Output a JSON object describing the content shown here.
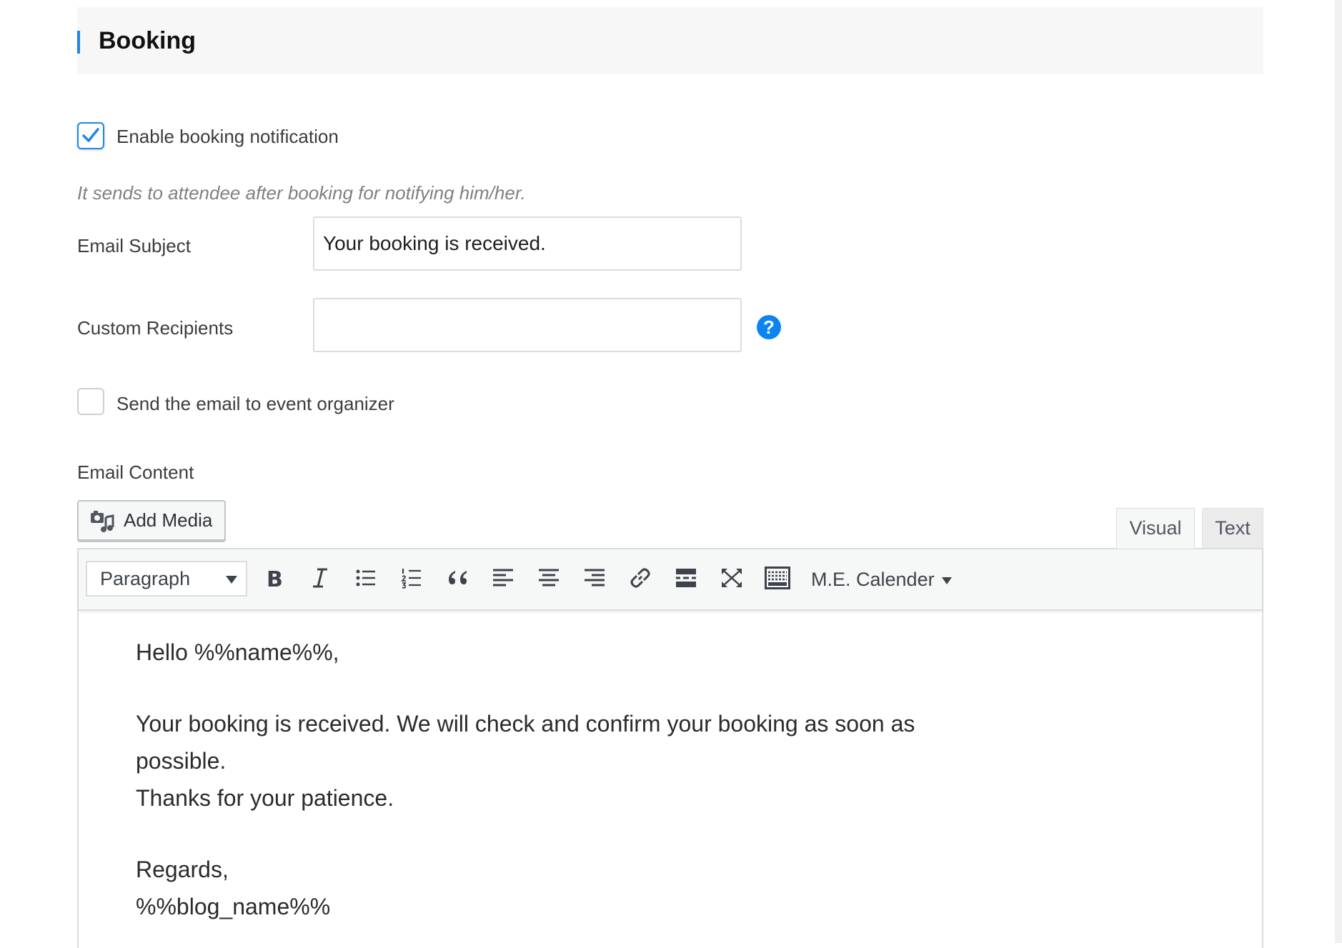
{
  "section": {
    "title": "Booking"
  },
  "enable_notification": {
    "label": "Enable booking notification",
    "checked": true
  },
  "description": "It sends to attendee after booking for notifying him/her.",
  "email_subject": {
    "label": "Email Subject",
    "value": "Your booking is received."
  },
  "custom_recipients": {
    "label": "Custom Recipients",
    "value": "",
    "help_icon": "question-circle-icon",
    "help_glyph": "?"
  },
  "send_to_organizer": {
    "label": "Send the email to event organizer",
    "checked": false
  },
  "email_content": {
    "label": "Email Content",
    "add_media_label": "Add Media",
    "tabs": {
      "visual": "Visual",
      "text": "Text",
      "active": "visual"
    },
    "toolbar": {
      "format_value": "Paragraph",
      "buttons": [
        "bold-icon",
        "italic-icon",
        "bullet-list-icon",
        "numbered-list-icon",
        "blockquote-icon",
        "align-left-icon",
        "align-center-icon",
        "align-right-icon",
        "link-icon",
        "read-more-icon",
        "fullscreen-icon",
        "toolbar-toggle-icon"
      ],
      "plugin_menu": "M.E. Calender"
    },
    "body": {
      "greeting": "Hello %%name%%,",
      "line1": "Your booking is received. We will check and confirm your booking as soon as",
      "line2": "possible.",
      "line3": "Thanks for your patience.",
      "sign_off": "Regards,",
      "signature": "%%blog_name%%"
    }
  },
  "colors": {
    "accent": "#1e88e5",
    "help": "#0b84f3",
    "header_bg": "#f7f7f7"
  }
}
